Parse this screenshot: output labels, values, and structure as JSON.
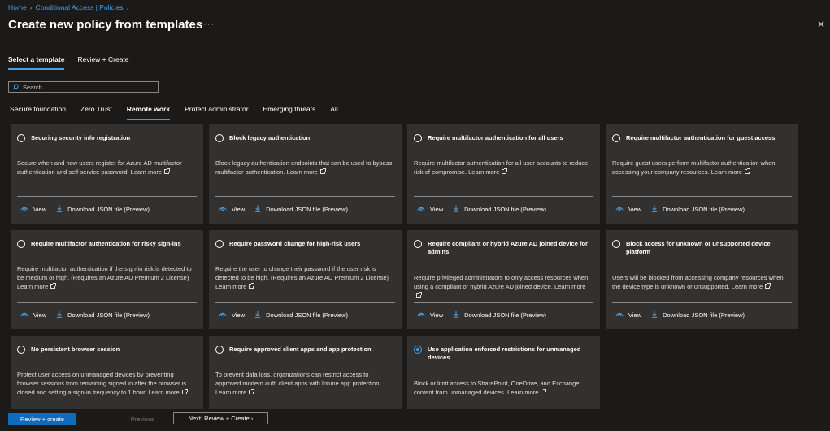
{
  "breadcrumb": [
    "Home",
    "Conditional Access | Policies"
  ],
  "page_title": "Create new policy from templates",
  "more_label": "···",
  "close_label": "✕",
  "wizard_tabs": [
    {
      "label": "Select a template",
      "active": true
    },
    {
      "label": "Review + Create",
      "active": false
    }
  ],
  "search": {
    "placeholder": "Search"
  },
  "category_tabs": [
    {
      "label": "Secure foundation",
      "active": false
    },
    {
      "label": "Zero Trust",
      "active": false
    },
    {
      "label": "Remote work",
      "active": true
    },
    {
      "label": "Protect administrator",
      "active": false
    },
    {
      "label": "Emerging threats",
      "active": false
    },
    {
      "label": "All",
      "active": false
    }
  ],
  "card_actions": {
    "view": "View",
    "download": "Download JSON file (Preview)",
    "learn_more": "Learn more"
  },
  "cards": [
    {
      "title": "Securing security info registration",
      "desc": "Secure when and how users register for Azure AD multifactor authentication and self-service password.",
      "selected": false
    },
    {
      "title": "Block legacy authentication",
      "desc": "Block legacy authentication endpoints that can be used to bypass multifactor authentication.",
      "selected": false
    },
    {
      "title": "Require multifactor authentication for all users",
      "desc": "Require multifactor authentication for all user accounts to reduce risk of compromise.",
      "selected": false
    },
    {
      "title": "Require multifactor authentication for guest access",
      "desc": "Require guest users perform multifactor authentication when accessing your company resources.",
      "selected": false
    },
    {
      "title": "Require multifactor authentication for risky sign-ins",
      "desc": "Require multifactor authentication if the sign-in risk is detected to be medium or high. (Requires an Azure AD Premium 2 License)",
      "selected": false
    },
    {
      "title": "Require password change for high-risk users",
      "desc": "Require the user to change their password if the user risk is detected to be high. (Requires an Azure AD Premium 2 License)",
      "selected": false
    },
    {
      "title": "Require compliant or hybrid Azure AD joined device for admins",
      "desc": "Require privileged administrators to only access resources when using a compliant or hybrid Azure AD joined device.",
      "selected": false
    },
    {
      "title": "Block access for unknown or unsupported device platform",
      "desc": "Users will be blocked from accessing company resources when the device type is unknown or unsupported.",
      "selected": false
    },
    {
      "title": "No persistent browser session",
      "desc": "Protect user access on unmanaged devices by preventing browser sessions from remaining signed in after the browser is closed and setting a sign-in frequency to 1 hour.",
      "selected": false
    },
    {
      "title": "Require approved client apps and app protection",
      "desc": "To prevent data loss, organizations can restrict access to approved modern auth client apps with Intune app protection.",
      "selected": false
    },
    {
      "title": "Use application enforced restrictions for unmanaged devices",
      "desc": "Block or limit access to SharePoint, OneDrive, and Exchange content from unmanaged devices.",
      "selected": true
    }
  ],
  "footer": {
    "primary": "Review + create",
    "previous": "‹  Previous",
    "next": "Next: Review + Create  ›"
  },
  "colors": {
    "accent": "#4aa0e6",
    "primary_button": "#0f6cbd",
    "card_bg": "#323130",
    "page_bg": "#1b1a19"
  }
}
